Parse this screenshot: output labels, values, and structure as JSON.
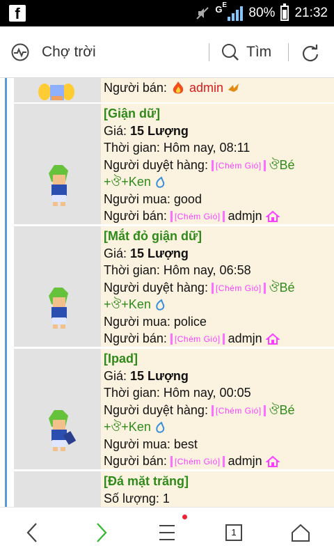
{
  "statusbar": {
    "network_label": "G",
    "network_sub": "E",
    "battery_percent": "80%",
    "battery_level": 0.8,
    "time": "21:32"
  },
  "toolbar": {
    "title": "Chợ trời",
    "search_label": "Tìm"
  },
  "colors": {
    "item_title": "#2f8a1a",
    "row_bg": "#fbf3e0",
    "avatar_bg": "#e2e2e2",
    "tag_pink": "#ff3fff",
    "admin_red": "#d61c1c"
  },
  "listing": {
    "partial_top": {
      "seller_label": "Người bán:",
      "seller_name": "admin"
    },
    "rows": [
      {
        "title": "[Giận dữ]",
        "price_label": "Giá:",
        "price": "15 Lượng",
        "time_label": "Thời gian:",
        "time": "Hôm nay, 08:11",
        "approver_label": "Người duyệt hàng:",
        "approver_tag": "[Chém Gió]",
        "approver_name1": "Bé",
        "approver_name2": "+Ken",
        "buyer_label": "Người mua:",
        "buyer": "good",
        "seller_label": "Người bán:",
        "seller_tag": "[Chém Gió]",
        "seller": "admjn"
      },
      {
        "title": "[Mắt đỏ giận dữ]",
        "price_label": "Giá:",
        "price": "15 Lượng",
        "time_label": "Thời gian:",
        "time": "Hôm nay, 06:58",
        "approver_label": "Người duyệt hàng:",
        "approver_tag": "[Chém Gió]",
        "approver_name1": "Bé",
        "approver_name2": "+Ken",
        "buyer_label": "Người mua:",
        "buyer": "police",
        "seller_label": "Người bán:",
        "seller_tag": "[Chém Gió]",
        "seller": "admjn"
      },
      {
        "title": "[Ipad]",
        "price_label": "Giá:",
        "price": "15 Lượng",
        "time_label": "Thời gian:",
        "time": "Hôm nay, 00:05",
        "approver_label": "Người duyệt hàng:",
        "approver_tag": "[Chém Gió]",
        "approver_name1": "Bé",
        "approver_name2": "+Ken",
        "buyer_label": "Người mua:",
        "buyer": "best",
        "seller_label": "Người bán:",
        "seller_tag": "[Chém Gió]",
        "seller": "admjn"
      }
    ],
    "partial_bottom": {
      "title": "[Đá mặt trăng]",
      "qty_label": "Số lượng:",
      "qty": "1"
    }
  },
  "bottomnav": {
    "tab_count": "1"
  }
}
